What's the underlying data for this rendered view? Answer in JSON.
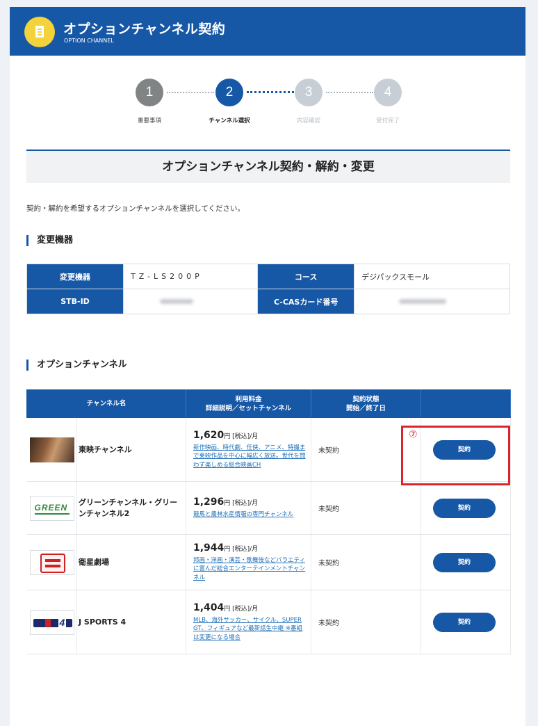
{
  "header": {
    "title": "オプションチャンネル契約",
    "subtitle": "OPTION CHANNEL"
  },
  "steps": [
    {
      "number": "1",
      "label": "重要事項",
      "state": "done"
    },
    {
      "number": "2",
      "label": "チャンネル選択",
      "state": "active"
    },
    {
      "number": "3",
      "label": "内容確認",
      "state": "todo"
    },
    {
      "number": "4",
      "label": "受付完了",
      "state": "todo"
    }
  ],
  "page_title": "オプションチャンネル契約・解約・変更",
  "instruction": "契約・解約を希望するオプションチャンネルを選択してください。",
  "device_section": {
    "heading": "変更機器",
    "rows": [
      {
        "k1": "変更機器",
        "v1": "TZ-LS200P",
        "k2": "コース",
        "v2": "デジパックスモール"
      },
      {
        "k1": "STB-ID",
        "v1": "",
        "k2": "C-CASカード番号",
        "v2": ""
      }
    ]
  },
  "channel_section": {
    "heading": "オプションチャンネル",
    "columns": {
      "name": "チャンネル名",
      "fee_line1": "利用料金",
      "fee_line2": "詳細説明／セットチャンネル",
      "status_line1": "契約状態",
      "status_line2": "開始／終了日",
      "action": ""
    },
    "rows": [
      {
        "name": "東映チャンネル",
        "amount": "1,620",
        "unit": "円 [税込]/月",
        "desc": "新作映画、時代劇、任侠、アニメ、特撮まで東映作品を中心に幅広く放送。世代を問わず楽しめる総合映画CH",
        "status": "未契約",
        "button": "契約",
        "logo": "toei-channel-logo"
      },
      {
        "name": "グリーンチャンネル・グリーンチャンネル2",
        "amount": "1,296",
        "unit": "円 [税込]/月",
        "desc": "競馬と農林水産情報の専門チャンネル",
        "status": "未契約",
        "button": "契約",
        "logo": "green-channel-logo",
        "logo_text": "GREEN"
      },
      {
        "name": "衛星劇場",
        "amount": "1,944",
        "unit": "円 [税込]/月",
        "desc": "邦画・洋画・演芸・歌舞伎などバラエティに富んだ総合エンターテインメントチャンネル",
        "status": "未契約",
        "button": "契約",
        "logo": "eisei-gekijo-logo"
      },
      {
        "name": "J SPORTS 4",
        "amount": "1,404",
        "unit": "円 [税込]/月",
        "desc": "MLB、海外サッカー、サイクル、SUPER GT、フィギュアなど最新話生中継 ※番組は変更になる場合",
        "status": "未契約",
        "button": "契約",
        "logo": "j-sports-4-logo",
        "logo_text": "4"
      }
    ]
  },
  "annotation": {
    "marker": "⑦",
    "color": "#d9262c"
  },
  "colors": {
    "primary": "#1657a6",
    "accent": "#f3d23b",
    "link": "#1f6fb8"
  }
}
